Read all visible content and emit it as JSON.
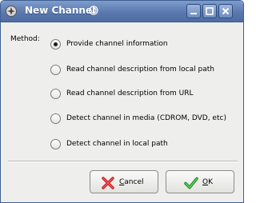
{
  "window": {
    "title": "New Channel",
    "colors": {
      "titlebar": "#5b79ad",
      "background": "#eeeeec"
    }
  },
  "form": {
    "method_label": "Method:",
    "options": [
      {
        "label": "Provide channel information",
        "selected": true
      },
      {
        "label": "Read channel description from local path",
        "selected": false
      },
      {
        "label": "Read channel description from URL",
        "selected": false
      },
      {
        "label": "Detect channel in media (CDROM, DVD, etc)",
        "selected": false
      },
      {
        "label": "Detect channel in local path",
        "selected": false
      }
    ]
  },
  "buttons": {
    "cancel": {
      "mnemonic": "C",
      "rest": "ancel",
      "icon": "red-x-icon"
    },
    "ok": {
      "mnemonic": "O",
      "rest": "K",
      "icon": "green-check-icon"
    }
  },
  "titlebar_buttons": [
    "minimize-icon",
    "maximize-icon",
    "close-icon"
  ]
}
